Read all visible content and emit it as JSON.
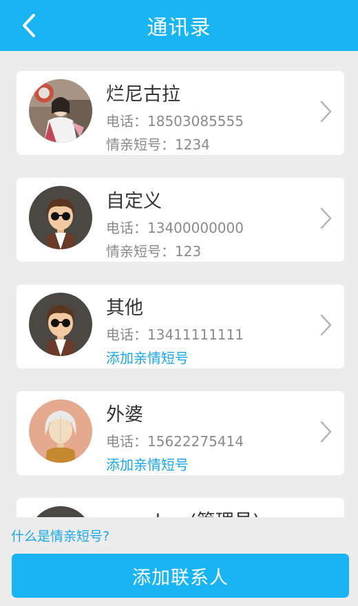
{
  "header": {
    "title": "通讯录",
    "back_icon": "chevron-left-icon",
    "color": "#18b4f3"
  },
  "contacts": [
    {
      "name": "烂尼古拉",
      "phone": "电话：18503085555",
      "short_number": "情亲短号：1234",
      "avatar": "photo-avatar"
    },
    {
      "name": "自定义",
      "phone": "电话：13400000000",
      "short_number": "情亲短号：123",
      "avatar": "young-man-sunglasses-avatar"
    },
    {
      "name": "其他",
      "phone": "电话：13411111111",
      "short_number": "添加亲情短号",
      "avatar": "young-man-sunglasses-avatar"
    },
    {
      "name": "外婆",
      "phone": "电话：15622275414",
      "short_number": "添加亲情短号",
      "avatar": "grandma-avatar"
    },
    {
      "name": "grandpa (管理员)",
      "avatar": "grandpa-avatar"
    }
  ],
  "footer": {
    "help_link": "什么是情亲短号?",
    "add_button": "添加联系人"
  },
  "colors": {
    "accent": "#18b4f3",
    "link": "#18a8ea",
    "background": "#ececec"
  }
}
